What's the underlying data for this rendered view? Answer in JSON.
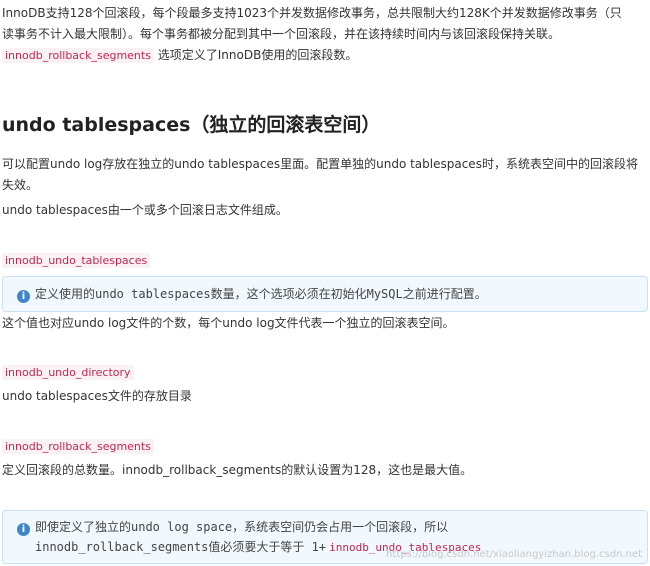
{
  "intro": {
    "line1": "InnoDB支持128个回滚段，每个段最多支持1023个并发数据修改事务，总共限制大约128K个并发数据修改事务（只",
    "line2": "读事务不计入最大限制）。每个事务都被分配到其中一个回滚段，并在该持续时间内与该回滚段保持关联。",
    "code": "innodb_rollback_segments",
    "line3_after": " 选项定义了InnoDB使用的回滚段数。"
  },
  "section": {
    "title": "undo tablespaces（独立的回滚表空间）"
  },
  "para1": {
    "line1": "可以配置undo log存放在独立的undo tablespaces里面。配置单独的undo tablespaces时，系统表空间中的回滚段将",
    "line2": "失效。"
  },
  "para2": "undo tablespaces由一个或多个回滚日志文件组成。",
  "opt1": {
    "code": "innodb_undo_tablespaces",
    "note": "定义使用的undo tablespaces数量，这个选项必须在初始化MySQL之前进行配置。",
    "desc": "这个值也对应undo log文件的个数，每个undo log文件代表一个独立的回滚表空间。"
  },
  "opt2": {
    "code": "innodb_undo_directory",
    "desc": "undo tablespaces文件的存放目录"
  },
  "opt3": {
    "code": "innodb_rollback_segments",
    "desc": "定义回滚段的总数量。innodb_rollback_segments的默认设置为128，这也是最大值。"
  },
  "final_note": {
    "line1": "即使定义了独立的undo log space，系统表空间仍会占用一个回滚段，所以",
    "line2_before": "innodb_rollback_segments值必须要大于等于  1+",
    "line2_code": "innodb_undo_tablespaces"
  },
  "watermark": "https://blog.csdn.net/xiaoliangyizhan.blog.csdn.net"
}
